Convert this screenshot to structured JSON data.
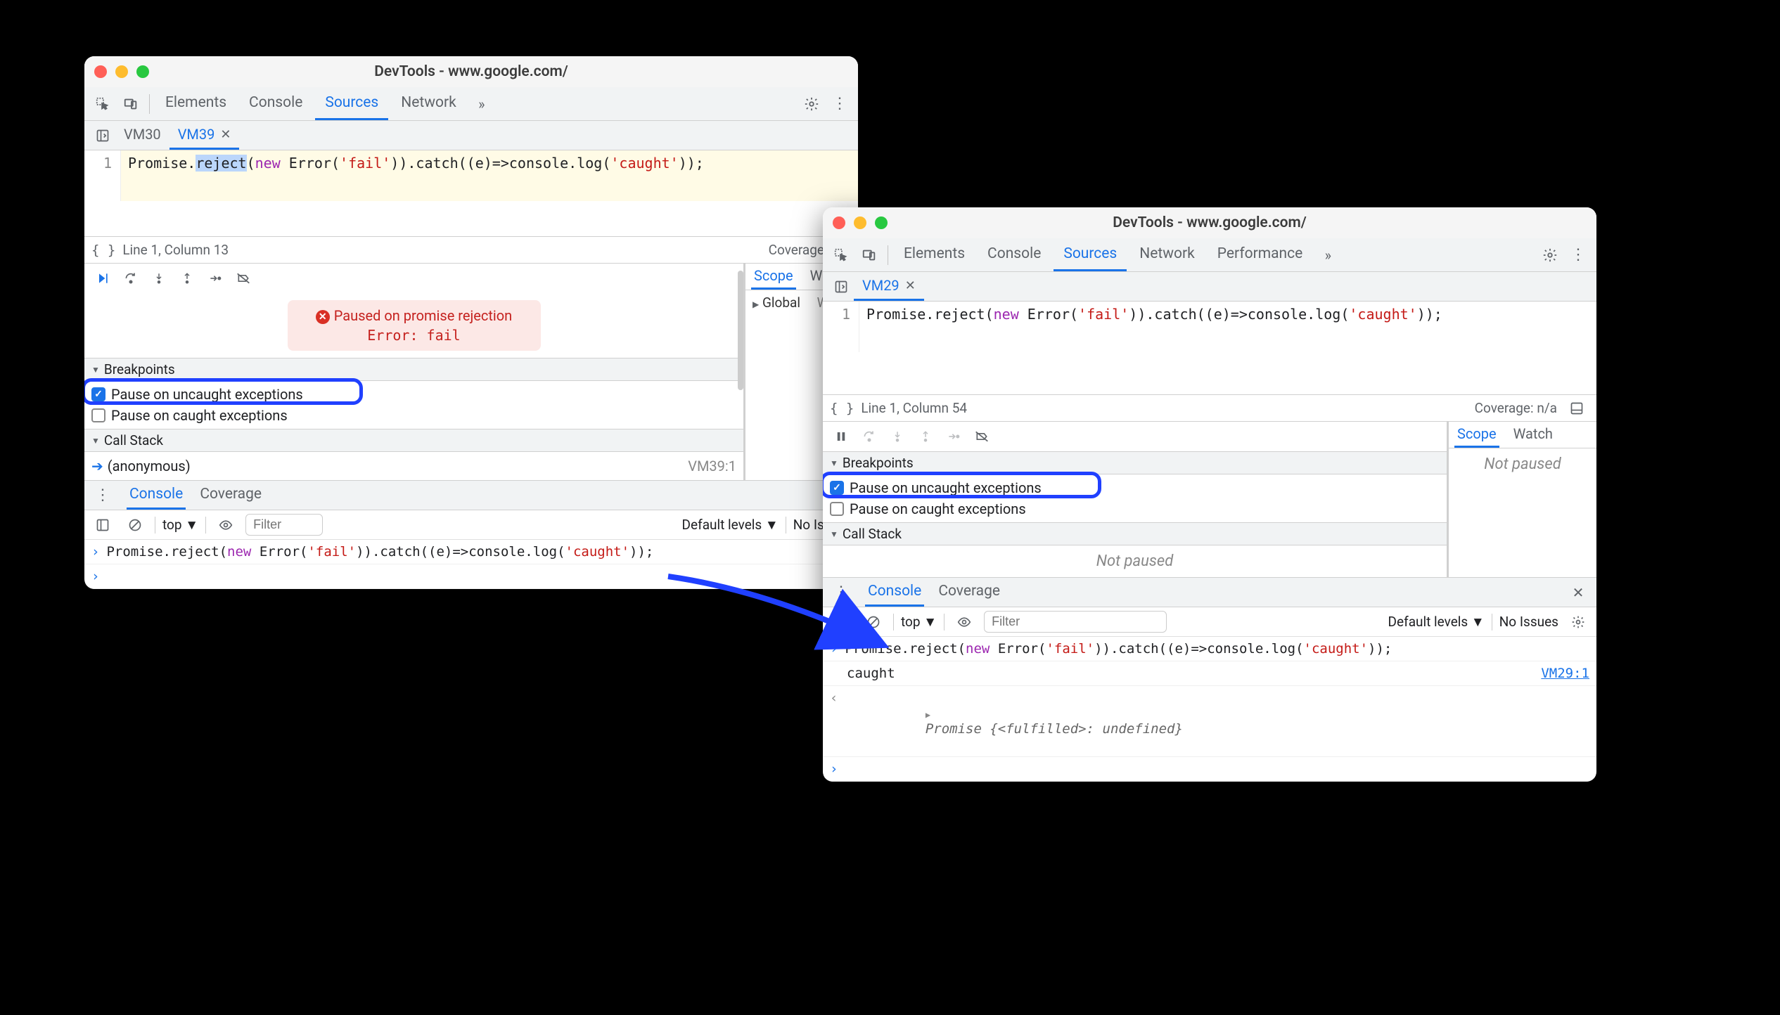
{
  "left": {
    "title": "DevTools - www.google.com/",
    "tabs": [
      "Elements",
      "Console",
      "Sources",
      "Network"
    ],
    "activeTab": "Sources",
    "fileTabs": {
      "inactive": "VM30",
      "active": "VM39"
    },
    "code": {
      "lineNum": "1",
      "pre": "Promise.",
      "sel": "reject",
      "mid1": "(",
      "kw": "new",
      "mid2": " Error(",
      "str1": "'fail'",
      "mid3": ")).catch((e)=>console.log(",
      "str2": "'caught'",
      "mid4": "));"
    },
    "status": {
      "left": "Line 1, Column 13",
      "right": "Coverage: n/a"
    },
    "scopeTabs": {
      "active": "Scope",
      "other": "Watch"
    },
    "scope": {
      "label": "Global",
      "val": "Win"
    },
    "pause": {
      "title": "Paused on promise rejection",
      "sub": "Error: fail"
    },
    "bpHeader": "Breakpoints",
    "bpUncaught": "Pause on uncaught exceptions",
    "bpCaught": "Pause on caught exceptions",
    "csHeader": "Call Stack",
    "csRow": {
      "name": "(anonymous)",
      "src": "VM39:1"
    },
    "drawerTabs": {
      "active": "Console",
      "other": "Coverage"
    },
    "consoleToolbar": {
      "context": "top",
      "filter": "Filter",
      "levels": "Default levels",
      "issues": "No Issues"
    },
    "consoleInput": {
      "pre": "Promise.reject(",
      "kw": "new",
      "mid1": " Error(",
      "str1": "'fail'",
      "mid2": ")).catch((e)=>console.log(",
      "str2": "'caught'",
      "mid3": "));"
    }
  },
  "right": {
    "title": "DevTools - www.google.com/",
    "tabs": [
      "Elements",
      "Console",
      "Sources",
      "Network",
      "Performance"
    ],
    "activeTab": "Sources",
    "fileTabs": {
      "active": "VM29"
    },
    "code": {
      "lineNum": "1",
      "pre": "Promise.reject(",
      "kw": "new",
      "mid1": " Error(",
      "str1": "'fail'",
      "mid2": ")).catch((e)=>console.log(",
      "str2": "'caught'",
      "mid3": "));"
    },
    "status": {
      "left": "Line 1, Column 54",
      "right": "Coverage: n/a"
    },
    "scopeTabs": {
      "active": "Scope",
      "other": "Watch"
    },
    "notPaused": "Not paused",
    "bpHeader": "Breakpoints",
    "bpUncaught": "Pause on uncaught exceptions",
    "bpCaught": "Pause on caught exceptions",
    "csHeader": "Call Stack",
    "drawerTabs": {
      "active": "Console",
      "other": "Coverage"
    },
    "consoleToolbar": {
      "context": "top",
      "filter": "Filter",
      "levels": "Default levels",
      "issues": "No Issues"
    },
    "consoleInput": {
      "pre": "Promise.reject(",
      "kw": "new",
      "mid1": " Error(",
      "str1": "'fail'",
      "mid2": ")).catch((e)=>console.log(",
      "str2": "'caught'",
      "mid3": "));"
    },
    "consoleOut1": {
      "text": "caught",
      "src": "VM29:1"
    },
    "consoleOut2": {
      "pre": "Promise {",
      "mid": "<fulfilled>: undefined",
      "post": "}"
    }
  }
}
